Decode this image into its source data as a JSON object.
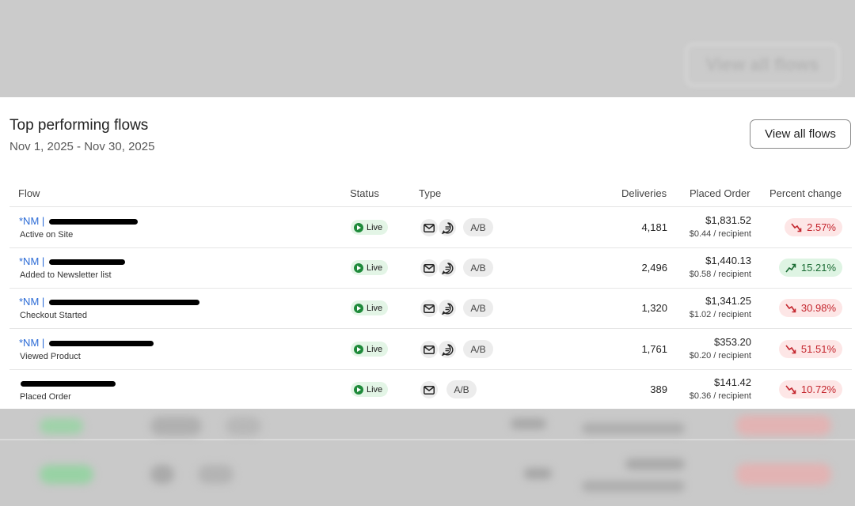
{
  "background": {
    "ghost_button_label": "View all flows"
  },
  "card": {
    "title": "Top performing flows",
    "date_range": "Nov 1, 2025 - Nov 30, 2025",
    "view_all_label": "View all flows"
  },
  "table": {
    "headers": {
      "flow": "Flow",
      "status": "Status",
      "type": "Type",
      "deliveries": "Deliveries",
      "placed_order": "Placed Order",
      "percent_change": "Percent change"
    },
    "rows": [
      {
        "name_prefix": "*NM | ",
        "trigger": "Active on Site",
        "status": "Live",
        "channels": [
          "email",
          "sms"
        ],
        "ab": "A/B",
        "deliveries": "4,181",
        "placed_order": "$1,831.52",
        "per_recipient": "$0.44 / recipient",
        "change": "2.57%",
        "trend": "down"
      },
      {
        "name_prefix": "*NM | ",
        "trigger": "Added to Newsletter list",
        "status": "Live",
        "channels": [
          "email",
          "sms"
        ],
        "ab": "A/B",
        "deliveries": "2,496",
        "placed_order": "$1,440.13",
        "per_recipient": "$0.58 / recipient",
        "change": "15.21%",
        "trend": "up"
      },
      {
        "name_prefix": "*NM | ",
        "trigger": "Checkout Started",
        "status": "Live",
        "channels": [
          "email",
          "sms"
        ],
        "ab": "A/B",
        "deliveries": "1,320",
        "placed_order": "$1,341.25",
        "per_recipient": "$1.02 / recipient",
        "change": "30.98%",
        "trend": "down"
      },
      {
        "name_prefix": "*NM | ",
        "trigger": "Viewed Product",
        "status": "Live",
        "channels": [
          "email",
          "sms"
        ],
        "ab": "A/B",
        "deliveries": "1,761",
        "placed_order": "$353.20",
        "per_recipient": "$0.20 / recipient",
        "change": "51.51%",
        "trend": "down"
      },
      {
        "name_prefix": "",
        "trigger": "Placed Order",
        "status": "Live",
        "channels": [
          "email"
        ],
        "ab": "A/B",
        "deliveries": "389",
        "placed_order": "$141.42",
        "per_recipient": "$0.36 / recipient",
        "change": "10.72%",
        "trend": "down"
      }
    ]
  },
  "colors": {
    "link": "#2b6bd6",
    "live": "#1e8a3a",
    "negative": "#c4262e",
    "positive": "#1a6b33"
  }
}
